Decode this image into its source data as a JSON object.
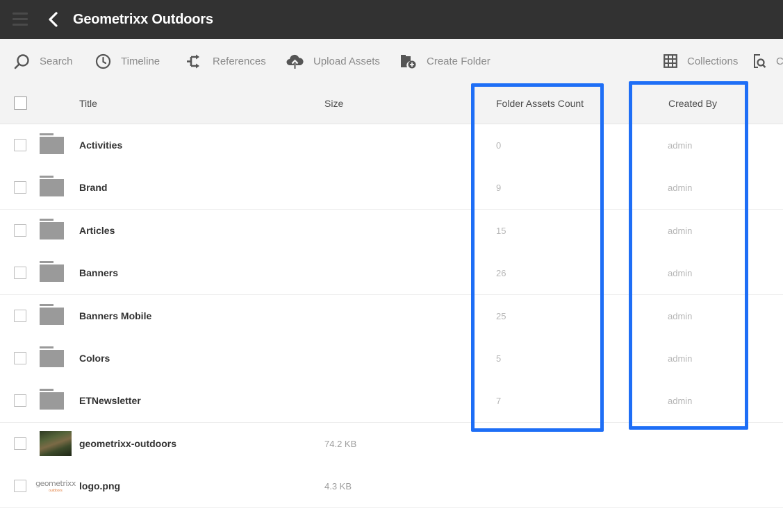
{
  "header": {
    "title": "Geometrixx Outdoors"
  },
  "toolbar": {
    "search": "Search",
    "timeline": "Timeline",
    "references": "References",
    "upload": "Upload Assets",
    "create_folder": "Create Folder",
    "collections": "Collections",
    "cut_label": "C"
  },
  "table": {
    "columns": {
      "title": "Title",
      "size": "Size",
      "count": "Folder Assets Count",
      "created_by": "Created By"
    },
    "rows": [
      {
        "name": "Activities",
        "size": "",
        "count": "0",
        "created_by": "admin",
        "kind": "folder"
      },
      {
        "name": "Brand",
        "size": "",
        "count": "9",
        "created_by": "admin",
        "kind": "folder"
      },
      {
        "name": "Articles",
        "size": "",
        "count": "15",
        "created_by": "admin",
        "kind": "folder"
      },
      {
        "name": "Banners",
        "size": "",
        "count": "26",
        "created_by": "admin",
        "kind": "folder"
      },
      {
        "name": "Banners Mobile",
        "size": "",
        "count": "25",
        "created_by": "admin",
        "kind": "folder"
      },
      {
        "name": "Colors",
        "size": "",
        "count": "5",
        "created_by": "admin",
        "kind": "folder"
      },
      {
        "name": "ETNewsletter",
        "size": "",
        "count": "7",
        "created_by": "admin",
        "kind": "folder"
      },
      {
        "name": "geometrixx-outdoors",
        "size": "74.2 KB",
        "count": "",
        "created_by": "",
        "kind": "image"
      },
      {
        "name": "logo.png",
        "size": "4.3 KB",
        "count": "",
        "created_by": "",
        "kind": "logo"
      }
    ]
  },
  "logo_thumb": {
    "text": "geometrixx",
    "subtext": "outdoors"
  },
  "colors": {
    "header_bg": "#323232",
    "toolbar_bg": "#f3f3f3",
    "highlight": "#1e6ef6"
  }
}
